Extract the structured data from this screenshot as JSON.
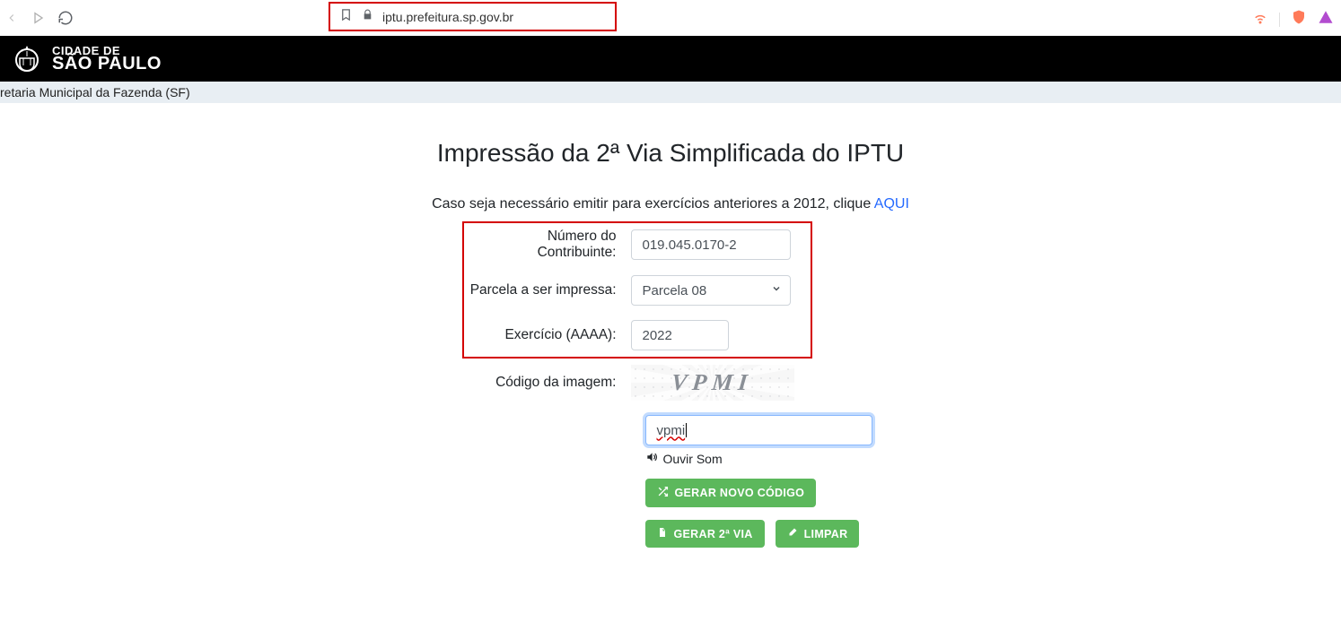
{
  "browser": {
    "url": "iptu.prefeitura.sp.gov.br"
  },
  "brand": {
    "line1": "CIDADE DE",
    "line2": "SÃO PAULO"
  },
  "sub_bar": "retaria Municipal da Fazenda (SF)",
  "page": {
    "title": "Impressão da 2ª Via Simplificada do IPTU",
    "subtext_prefix": "Caso seja necessário emitir para exercícios anteriores a 2012, clique ",
    "subtext_link": "AQUI"
  },
  "form": {
    "contribuinte_label": "Número do Contribuinte:",
    "contribuinte_value": "019.045.0170-2",
    "parcela_label": "Parcela a ser impressa:",
    "parcela_value": "Parcela 08",
    "exercicio_label": "Exercício (AAAA):",
    "exercicio_value": "2022",
    "captcha_label": "Código da imagem:",
    "captcha_image_text": "VPMI",
    "captcha_input_value": "vpmi",
    "audio_label": "Ouvir Som",
    "btn_new_code": "GERAR NOVO CÓDIGO",
    "btn_gerar": "GERAR 2ª VIA",
    "btn_limpar": "LIMPAR"
  }
}
